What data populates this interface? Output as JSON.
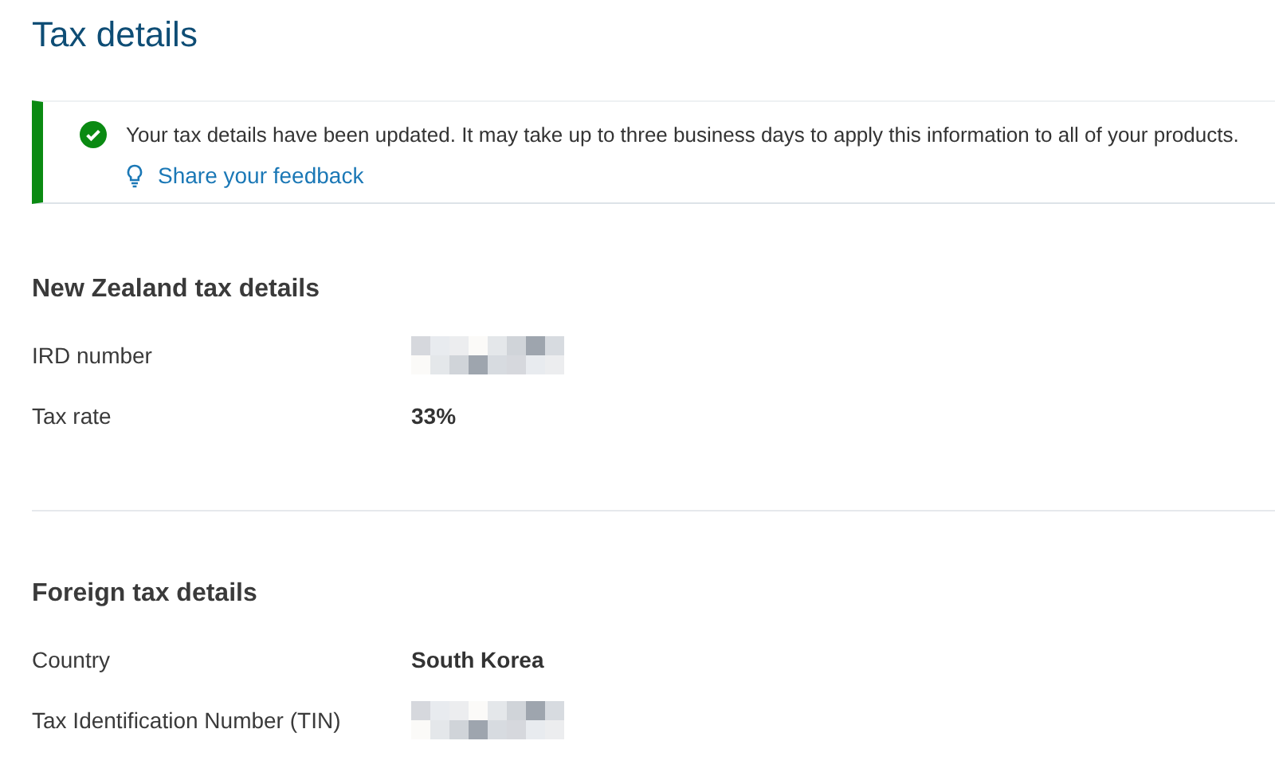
{
  "title": "Tax details",
  "notice": {
    "message": "Your tax details have been updated. It may take up to three business days to apply this information to all of your products.",
    "link": "Share your feedback"
  },
  "sections": [
    {
      "heading": "New Zealand tax details",
      "rows": [
        {
          "label": "IRD number",
          "kind": "hidden"
        },
        {
          "label": "Tax rate",
          "kind": "text",
          "value": "33%"
        }
      ]
    },
    {
      "heading": "Foreign tax details",
      "rows": [
        {
          "label": "Country",
          "kind": "text",
          "value": "South Korea"
        },
        {
          "label": "Tax Identification Number (TIN)",
          "kind": "hidden"
        }
      ]
    }
  ]
}
